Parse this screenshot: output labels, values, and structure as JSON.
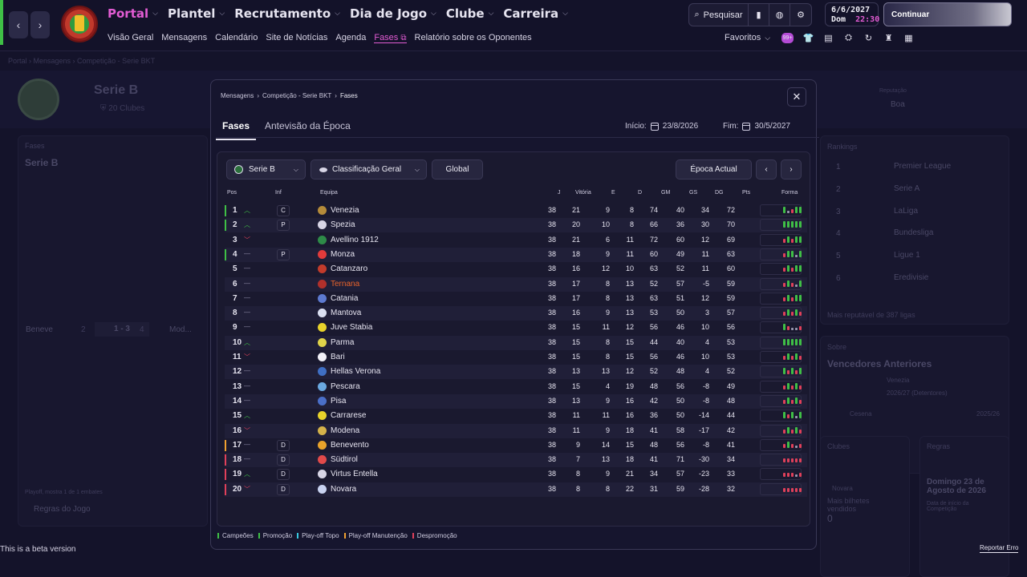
{
  "topbar": {
    "back_icon": "chevron-left",
    "forward_icon": "chevron-right",
    "main_nav": [
      {
        "label": "Portal",
        "active": true
      },
      {
        "label": "Plantel",
        "active": false
      },
      {
        "label": "Recrutamento",
        "active": false
      },
      {
        "label": "Dia de Jogo",
        "active": false
      },
      {
        "label": "Clube",
        "active": false
      },
      {
        "label": "Carreira",
        "active": false
      }
    ],
    "sub_nav": [
      "Visão Geral",
      "Mensagens",
      "Calendário",
      "Site de Notícias",
      "Agenda",
      "Fases",
      "Relatório sobre os Oponentes"
    ],
    "sub_nav_active": "Fases",
    "search_label": "Pesquisar",
    "date": "6/6/2027",
    "day": "Dom",
    "time": "22:30",
    "continue_label": "Continuar",
    "favorites_label": "Favoritos",
    "badge_text": "99+"
  },
  "background": {
    "crumbs": [
      "Portal",
      "Mensagens",
      "Competição - Serie BKT"
    ],
    "competition_title": "Serie B",
    "clubs_count": "20 Clubes",
    "reputation_label": "Reputação",
    "reputation_value": "Boa",
    "left_panel_heading": "Fases",
    "left_panel_title": "Serie B",
    "match_home": "Beneve",
    "match_home_pos": "2",
    "match_score": "1 - 3",
    "match_away_pos": "4",
    "match_away": "Mod...",
    "playoff_note": "Playoff, mostra 1 de 1 embates",
    "rules_link": "Regras do Jogo",
    "rankings_heading": "Rankings",
    "rankings": [
      {
        "pos": "1",
        "name": "Premier League"
      },
      {
        "pos": "2",
        "name": "Serie A"
      },
      {
        "pos": "3",
        "name": "LaLiga"
      },
      {
        "pos": "4",
        "name": "Bundesliga"
      },
      {
        "pos": "5",
        "name": "Ligue 1"
      },
      {
        "pos": "6",
        "name": "Eredivisie"
      }
    ],
    "rankings_footer": "Mais reputável de 387 ligas",
    "about_heading": "Sobre",
    "past_winners_title": "Vencedores Anteriores",
    "winner_name": "Venezia",
    "winner_season": "2026/27 (Detentores)",
    "winner2_name": "Cesena",
    "winner2_season": "2025/26",
    "clubs_heading": "Clubes",
    "club_name": "Novara",
    "tickets_note": "Mais bilhetes vendidos",
    "tickets_value": "0",
    "rules_heading": "Regras",
    "rules_date": "Domingo 23 de Agosto de 2026",
    "rules_date_note": "Data de início da Competição"
  },
  "modal": {
    "crumbs": [
      "Mensagens",
      "Competição - Serie BKT",
      "Fases"
    ],
    "tabs": [
      "Fases",
      "Antevisão da Época"
    ],
    "start_label": "Início:",
    "start_date": "23/8/2026",
    "end_label": "Fim:",
    "end_date": "30/5/2027",
    "controls": {
      "competition": "Serie B",
      "table_type": "Classificação Geral",
      "scope": "Global",
      "season": "Época Actual"
    },
    "columns": {
      "pos": "Pos",
      "inf": "Inf",
      "team": "Equipa",
      "j": "J",
      "v": "Vitória",
      "e": "E",
      "d": "D",
      "gm": "GM",
      "gs": "GS",
      "dg": "DG",
      "pts": "Pts",
      "form": "Forma"
    },
    "rows": [
      {
        "pos": "1",
        "trend": "up",
        "inf": "C",
        "team": "Venezia",
        "j": "38",
        "v": "21",
        "e": "9",
        "d": "8",
        "gm": "74",
        "gs": "40",
        "dg": "34",
        "pts": "72",
        "zone": "promo",
        "icolor": "#b58b3a",
        "form": "WDLWW"
      },
      {
        "pos": "2",
        "trend": "up",
        "inf": "P",
        "team": "Spezia",
        "j": "38",
        "v": "20",
        "e": "10",
        "d": "8",
        "gm": "66",
        "gs": "36",
        "dg": "30",
        "pts": "70",
        "zone": "promo",
        "icolor": "#d8d5e6",
        "form": "WWWWW"
      },
      {
        "pos": "3",
        "trend": "down",
        "inf": "",
        "team": "Avellino 1912",
        "j": "38",
        "v": "21",
        "e": "6",
        "d": "11",
        "gm": "72",
        "gs": "60",
        "dg": "12",
        "pts": "69",
        "zone": "",
        "icolor": "#2e8b48",
        "form": "LWLWW"
      },
      {
        "pos": "4",
        "trend": "same",
        "inf": "P",
        "team": "Monza",
        "j": "38",
        "v": "18",
        "e": "9",
        "d": "11",
        "gm": "60",
        "gs": "49",
        "dg": "11",
        "pts": "63",
        "zone": "promo",
        "icolor": "#e23b3b",
        "form": "LWWDW"
      },
      {
        "pos": "5",
        "trend": "same",
        "inf": "",
        "team": "Catanzaro",
        "j": "38",
        "v": "16",
        "e": "12",
        "d": "10",
        "gm": "63",
        "gs": "52",
        "dg": "11",
        "pts": "60",
        "zone": "",
        "icolor": "#c23b2b",
        "form": "LWLWW"
      },
      {
        "pos": "6",
        "trend": "same",
        "inf": "",
        "team": "Ternana",
        "j": "38",
        "v": "17",
        "e": "8",
        "d": "13",
        "gm": "52",
        "gs": "57",
        "dg": "-5",
        "pts": "59",
        "zone": "",
        "icolor": "#b0302b",
        "form": "LWLDW",
        "highlight": true
      },
      {
        "pos": "7",
        "trend": "same",
        "inf": "",
        "team": "Catania",
        "j": "38",
        "v": "17",
        "e": "8",
        "d": "13",
        "gm": "63",
        "gs": "51",
        "dg": "12",
        "pts": "59",
        "zone": "",
        "icolor": "#5d7ad0",
        "form": "LWLWW"
      },
      {
        "pos": "8",
        "trend": "same",
        "inf": "",
        "team": "Mantova",
        "j": "38",
        "v": "16",
        "e": "9",
        "d": "13",
        "gm": "53",
        "gs": "50",
        "dg": "3",
        "pts": "57",
        "zone": "",
        "icolor": "#dbe0f2",
        "form": "LWLWL"
      },
      {
        "pos": "9",
        "trend": "same",
        "inf": "",
        "team": "Juve Stabia",
        "j": "38",
        "v": "15",
        "e": "11",
        "d": "12",
        "gm": "56",
        "gs": "46",
        "dg": "10",
        "pts": "56",
        "zone": "",
        "icolor": "#e8d22b",
        "form": "WLDDL"
      },
      {
        "pos": "10",
        "trend": "up",
        "inf": "",
        "team": "Parma",
        "j": "38",
        "v": "15",
        "e": "8",
        "d": "15",
        "gm": "44",
        "gs": "40",
        "dg": "4",
        "pts": "53",
        "zone": "",
        "icolor": "#e0d44a",
        "form": "WWWWW"
      },
      {
        "pos": "11",
        "trend": "down",
        "inf": "",
        "team": "Bari",
        "j": "38",
        "v": "15",
        "e": "8",
        "d": "15",
        "gm": "56",
        "gs": "46",
        "dg": "10",
        "pts": "53",
        "zone": "",
        "icolor": "#f1f0f7",
        "form": "LWLWL"
      },
      {
        "pos": "12",
        "trend": "same",
        "inf": "",
        "team": "Hellas Verona",
        "j": "38",
        "v": "13",
        "e": "13",
        "d": "12",
        "gm": "52",
        "gs": "48",
        "dg": "4",
        "pts": "52",
        "zone": "",
        "icolor": "#3f6fc4",
        "form": "WLWLW"
      },
      {
        "pos": "13",
        "trend": "same",
        "inf": "",
        "team": "Pescara",
        "j": "38",
        "v": "15",
        "e": "4",
        "d": "19",
        "gm": "48",
        "gs": "56",
        "dg": "-8",
        "pts": "49",
        "zone": "",
        "icolor": "#6aa8e0",
        "form": "LWLWL"
      },
      {
        "pos": "14",
        "trend": "same",
        "inf": "",
        "team": "Pisa",
        "j": "38",
        "v": "13",
        "e": "9",
        "d": "16",
        "gm": "42",
        "gs": "50",
        "dg": "-8",
        "pts": "48",
        "zone": "",
        "icolor": "#4a6fc8",
        "form": "LWLWL"
      },
      {
        "pos": "15",
        "trend": "up",
        "inf": "",
        "team": "Carrarese",
        "j": "38",
        "v": "11",
        "e": "11",
        "d": "16",
        "gm": "36",
        "gs": "50",
        "dg": "-14",
        "pts": "44",
        "zone": "",
        "icolor": "#e8d22b",
        "form": "WLWDW"
      },
      {
        "pos": "16",
        "trend": "down",
        "inf": "",
        "team": "Modena",
        "j": "38",
        "v": "11",
        "e": "9",
        "d": "18",
        "gm": "41",
        "gs": "58",
        "dg": "-17",
        "pts": "42",
        "zone": "",
        "icolor": "#d4b24a",
        "form": "LWLWL"
      },
      {
        "pos": "17",
        "trend": "same",
        "inf": "D",
        "team": "Benevento",
        "j": "38",
        "v": "9",
        "e": "14",
        "d": "15",
        "gm": "48",
        "gs": "56",
        "dg": "-8",
        "pts": "41",
        "zone": "poff",
        "icolor": "#e8a22b",
        "form": "LWLDL"
      },
      {
        "pos": "18",
        "trend": "same",
        "inf": "D",
        "team": "Südtirol",
        "j": "38",
        "v": "7",
        "e": "13",
        "d": "18",
        "gm": "41",
        "gs": "71",
        "dg": "-30",
        "pts": "34",
        "zone": "rel",
        "icolor": "#e24a4a",
        "form": "LLLLL"
      },
      {
        "pos": "19",
        "trend": "up",
        "inf": "D",
        "team": "Virtus Entella",
        "j": "38",
        "v": "8",
        "e": "9",
        "d": "21",
        "gm": "34",
        "gs": "57",
        "dg": "-23",
        "pts": "33",
        "zone": "rel",
        "icolor": "#d8d5e6",
        "form": "LLLDL"
      },
      {
        "pos": "20",
        "trend": "down",
        "inf": "D",
        "team": "Novara",
        "j": "38",
        "v": "8",
        "e": "8",
        "d": "22",
        "gm": "31",
        "gs": "59",
        "dg": "-28",
        "pts": "32",
        "zone": "rel",
        "icolor": "#c8d2f0",
        "form": "LLLLL"
      }
    ],
    "legend": [
      {
        "label": "Campeões",
        "color": "#3fbf46"
      },
      {
        "label": "Promoção",
        "color": "#3fbf46"
      },
      {
        "label": "Play-off Topo",
        "color": "#38c9e0"
      },
      {
        "label": "Play-off Manutenção",
        "color": "#f0a030"
      },
      {
        "label": "Despromoção",
        "color": "#e0405a"
      }
    ]
  },
  "footer": {
    "beta_text": "This is a beta version",
    "report_label": "Reportar Erro"
  },
  "colors": {
    "accent": "#e25cd3",
    "win": "#3fbf46",
    "draw": "#9a98b0",
    "loss": "#e0405a",
    "highlight_team": "#e8632b"
  }
}
